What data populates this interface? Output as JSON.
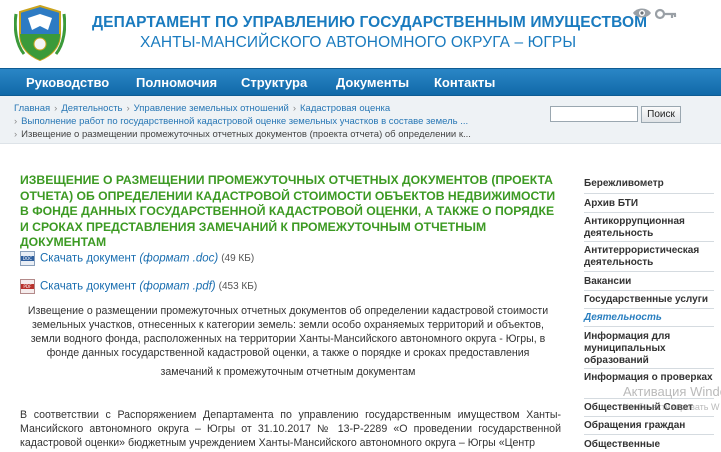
{
  "header": {
    "title": "ДЕПАРТАМЕНТ ПО УПРАВЛЕНИЮ ГОСУДАРСТВЕННЫМ ИМУЩЕСТВОМ",
    "subtitle": "ХАНТЫ-МАНСИЙСКОГО АВТОНОМНОГО ОКРУГА – ЮГРЫ"
  },
  "nav": [
    "Руководство",
    "Полномочия",
    "Структура",
    "Документы",
    "Контакты"
  ],
  "breadcrumbs": {
    "line1": [
      "Главная",
      "Деятельность",
      "Управление земельных отношений",
      "Кадастровая оценка"
    ],
    "line2": "Выполнение работ по государственной кадастровой оценке земельных участков в составе земель ...",
    "line3": "Извещение о размещении промежуточных отчетных документов (проекта отчета) об определении к..."
  },
  "search": {
    "button_label": "Поиск",
    "value": ""
  },
  "main": {
    "title": "ИЗВЕЩЕНИЕ О РАЗМЕЩЕНИИ ПРОМЕЖУТОЧНЫХ ОТЧЕТНЫХ ДОКУМЕНТОВ (ПРОЕКТА ОТЧЕТА) ОБ ОПРЕДЕЛЕНИИ КАДАСТРОВОЙ СТОИМОСТИ ОБЪЕКТОВ НЕДВИЖИМОСТИ В ФОНДЕ ДАННЫХ ГОСУДАРСТВЕННОЙ КАДАСТРОВОЙ ОЦЕНКИ, А ТАКЖЕ О ПОРЯДКЕ И СРОКАХ ПРЕДСТАВЛЕНИЯ ЗАМЕЧАНИЙ К ПРОМЕЖУТОЧНЫМ ОТЧЕТНЫМ ДОКУМЕНТАМ",
    "downloads": [
      {
        "label": "Скачать документ",
        "format": "(формат .doc)",
        "size": "(49 КБ)",
        "icon": "DOC"
      },
      {
        "label": "Скачать документ",
        "format": "(формат .pdf)",
        "size": "(453 КБ)",
        "icon": "PDF"
      }
    ],
    "announcement": "Извещение о размещении промежуточных отчетных документов об определении кадастровой стоимости земельных участков, отнесенных к категории земель: земли особо охраняемых территорий и объектов, земли водного фонда, расположенных на территории Ханты-Мансийского автономного округа - Югры, в фонде данных государственной кадастровой оценки, а также о порядке и сроках предоставления",
    "announcement_tail": "замечаний к промежуточным отчетным документам",
    "paragraph": "В соответствии с Распоряжением Департамента по управлению государственным имуществом Ханты-Мансийского автономного округа – Югры от 31.10.2017 № 13-Р-2289 «О проведении государственной кадастровой оценки» бюджетным учреждением Ханты-Мансийского автономного округа – Югры «Центр"
  },
  "side_menu": [
    "Бережливометр",
    "Архив БТИ",
    "Антикоррупционная деятельность",
    "Антитеррористическая деятельность",
    "Вакансии",
    "Государственные услуги",
    "Деятельность",
    "Информация для муниципальных образований",
    "Информация о проверках",
    "Общественный Совет",
    "Обращения граждан",
    "Общественные"
  ],
  "watermark": {
    "line1": "Активация Windo",
    "line2": "Чтобы активировать W"
  },
  "colors": {
    "brand_blue": "#1a7bbf",
    "nav_blue": "#1d78b8",
    "title_green": "#3c9a23",
    "link_blue": "#1a6eb0"
  }
}
